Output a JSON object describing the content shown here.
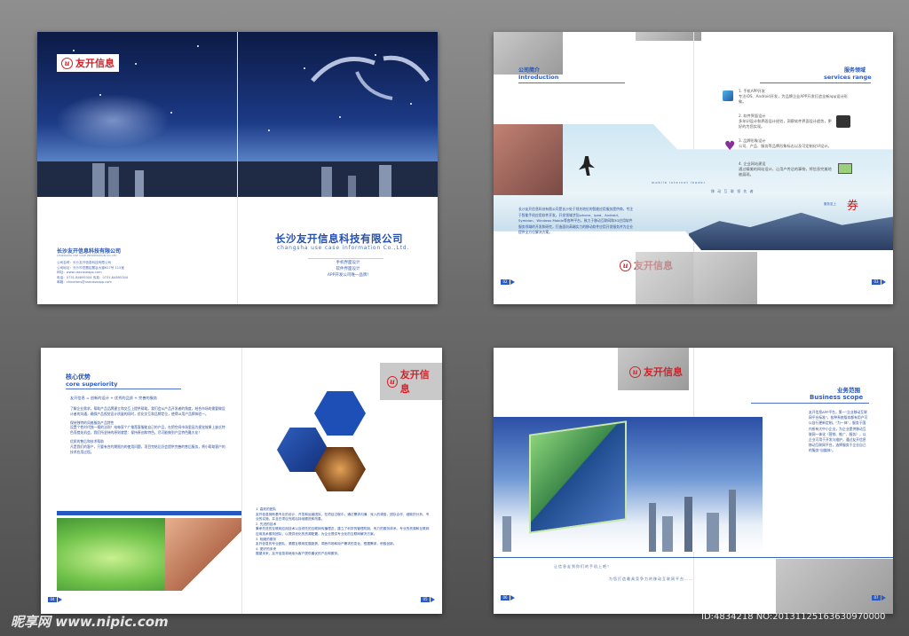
{
  "brand": {
    "logo_text": "友开信息",
    "logo_mark": "u",
    "accent": "#2a5cc4",
    "logo_red": "#d2232a"
  },
  "cover": {
    "company_name_cn": "长沙友开信息科技有限公司",
    "company_name_en": "changsha use case information Co.,Ltd.",
    "services": [
      "手机界面设计",
      "软件界面设计",
      "APP开发公司唯一品牌!"
    ],
    "small_name_cn": "长沙友开信息科技有限公司",
    "small_name_en": "CHANGSHA USE CASE INFORMATION CO.,LTD",
    "contact_lines": [
      "公司名称：长沙友开信息科技有限公司",
      "公司地址：长沙市岳麓区麓谷大道627号 115室",
      "网址：www.usecaseapp.com",
      "电话：0731-84895304  传真：0731-84895304",
      "邮箱：chinafans@usecaseapp.com"
    ]
  },
  "spread2": {
    "left_title_cn": "公司简介",
    "left_title_en": "Introduction",
    "right_title_cn": "服务领域",
    "right_title_en": "services range",
    "intro_text": "长沙友开信息科技有限公司是长沙处于领先地位的智能应用服务提供商，专注于智能手机应用软件开发，开发领域涉及iphone、ipad、Android、Symbian、Windows Mobile等各种平台，致力于移动互联网和3G应用软件服务领域的开发和研究，打造面向高端实力的移动软件应用开发服务并为企业提供全方位解决方案。",
    "banner_text": "移 动 互 联 领 先 者",
    "banner_text_en": "mobile internet leader",
    "services": [
      {
        "title": "1. 手机APP开发",
        "desc": "专注iOS、Android开发，为品牌企业APP开发打造全新app设计形象。"
      },
      {
        "title": "2. 软件界面设计",
        "desc": "多年UI设计和界面设计经验，洞察软件界面设计趋势，更好的为您实现。"
      },
      {
        "title": "3. 品牌形象设计",
        "desc": "公司、产品、服务等品牌形象标志以及可定制化VI设计。"
      },
      {
        "title": "4. 企业网站建设",
        "desc": "通过精美的网站设计，让用户传达的事物，将信息完美地被展现。"
      }
    ],
    "stamp_char": "券",
    "stamp_small": "服务至上",
    "page_left": "02",
    "page_right": "03"
  },
  "spread3": {
    "title_cn": "核心优势",
    "title_en": "core superiority",
    "intro": "友开信息 = 创新的设计 + 优秀的品质 + 完善的服务",
    "paragraphs": [
      "了解企业需求，帮助产品品牌建立和交互上提供帮助。我们会从产品开发者的角度，结合市场的需要做设计者的沟通，确保产品视觉设计质量的同时，优化交互和品牌定位，使得UI用户品牌体验一。",
      "保持独特的风格服务产品特性",
      "设置个性时代独一视的法则！给每家个广推荐客服能自己的产品，在把空间市场里因为视觉效果上缺乏特色而错失机会，我们所坚持的原则就是：保持原创和特色，尽可能做到产品特色最大化！",
      "优质的售后和技术帮助",
      "凡是我们的客户，只要有合约期限内的使用问题，项目完结后仍会提供完善的售后服务，将小帮助客户的技术应用过程。"
    ],
    "list": [
      {
        "title": "1. 高效的团队",
        "text": "友开信息拥有着专业的设计、开发和运营团队，在项目过程中，通过需求沟通、深入的调查，团队合作，细致的分析，专业的实施，并且在项目完成后持续跟进和改善。"
      },
      {
        "title": "2. 先进的技术",
        "text": "秉承先进的互联网应用技术以及领先的互联网传播理念，建立了科学的管理机制，有力的服务体系，专业的资源和互联网应用技术服务团队，以提供优化的资源配置，为企业提供专业化的互联网解决方案。"
      },
      {
        "title": "3. 相媲的服务",
        "text": "友开信息的专业团队，紧跟互联网发展趋势，洞悉市场和用户需求的变化，根据需求，积极创新。"
      },
      {
        "title": "4. 更好的未来",
        "text": "展望未来，友开信息将继续为客户提供最优的产品和服务。"
      }
    ],
    "page_left": "04",
    "page_right": "05"
  },
  "spread4": {
    "title_cn": "业务范围",
    "title_en": "Business scope",
    "text": "友开信息APP平台，第一\"企业移动互联网平台标准\"，各种系统版本都有用户可以自行更新定制。\"为一体\"，服务于国内所有大中小企业，为企业提供移动互联网一体化（营销、推广、服务），以企业可用于开发与维护，通过友开信息移动互联网平台，选择服务于企业自己的服务\"自媒体\"。",
    "caption1": "让信息走到你们的手机上吧！",
    "caption2": "为您打造最具竞争力的移动互联网平台……",
    "page_left": "06",
    "page_right": "07"
  },
  "watermark": {
    "site": "昵享网 www.nipic.com",
    "id": "ID:4834218 NO:20131125163630970000"
  }
}
